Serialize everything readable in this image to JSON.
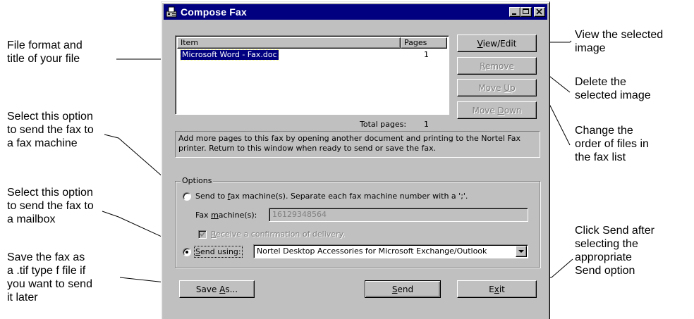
{
  "window": {
    "title": "Compose Fax",
    "controls": {
      "minimize": "minimize",
      "maximize": "maximize",
      "close": "close"
    }
  },
  "list": {
    "col_item": "Item",
    "col_pages": "Pages",
    "rows": [
      {
        "item": "Microsoft Word - Fax.doc",
        "pages": "1"
      }
    ],
    "total_label": "Total pages:",
    "total_value": "1"
  },
  "buttons": {
    "view_edit": {
      "pre": "",
      "key": "V",
      "post": "iew/Edit"
    },
    "remove": {
      "pre": "",
      "key": "R",
      "post": "emove"
    },
    "move_up": {
      "pre": "Move ",
      "key": "U",
      "post": "p"
    },
    "move_down": {
      "pre": "Move ",
      "key": "D",
      "post": "own"
    },
    "save_as": {
      "pre": "Save ",
      "key": "A",
      "post": "s..."
    },
    "send": {
      "pre": "",
      "key": "S",
      "post": "end"
    },
    "exit": {
      "pre": "E",
      "key": "x",
      "post": "it"
    }
  },
  "info_text": "Add more pages to this fax by opening another document and printing to the Nortel Fax printer.  Return to this window when ready to send or save the fax.",
  "options": {
    "legend": "Options",
    "radio_fax": {
      "pre": "Send to ",
      "key": "f",
      "post": "ax machine(s). Separate each fax machine number with a ';'."
    },
    "fax_field_label": {
      "pre": "Fax ",
      "key": "m",
      "post": "achine(s):"
    },
    "fax_field_value": "16129348564",
    "confirm_label": {
      "pre": "",
      "key": "R",
      "post": "eceive a confirmation of delivery."
    },
    "radio_send_using": {
      "pre": "",
      "key": "S",
      "post": "end using:"
    },
    "send_using_value": "Nortel Desktop Accessories for Microsoft Exchange/Outlook"
  },
  "callouts": {
    "file_format": "File format and\ntitle of your file",
    "fax_machine": "Select this option\nto send the fax to\na fax machine",
    "mailbox": "Select this option\nto send the fax to\na mailbox",
    "save": "Save the fax as\na .tif type f file if\nyou want to send\nit later",
    "view": "View the selected\nimage",
    "delete": "Delete the\nselected image",
    "order": "Change the\norder of files in\nthe fax list",
    "send": "Click Send after\nselecting the\nappropriate\nSend option"
  },
  "colors": {
    "titlebar": "#000080",
    "face": "#c0c0c0",
    "selection": "#000080"
  }
}
